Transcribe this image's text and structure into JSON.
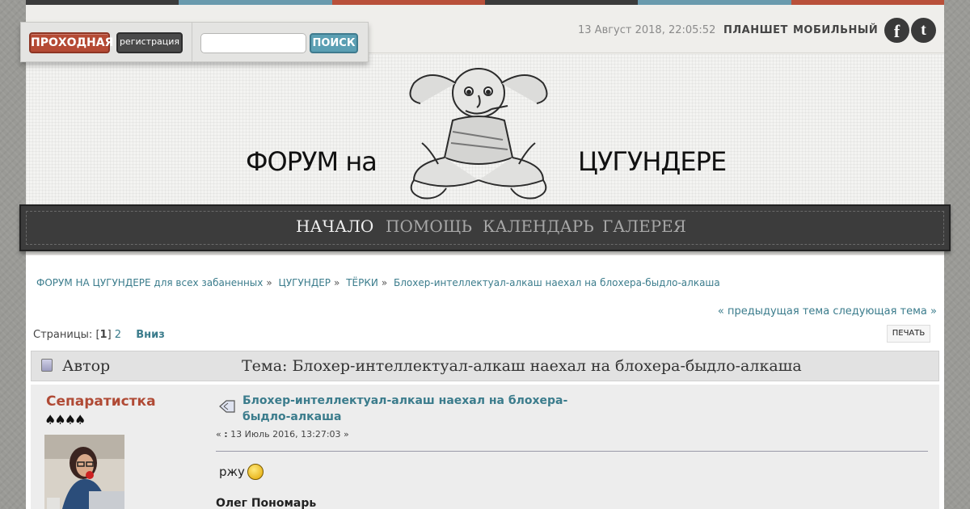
{
  "colors": {
    "stripes": [
      "#3b3b3b",
      "#6a9aad",
      "#b9503a",
      "#3b3b3b",
      "#6a9aad",
      "#b9503a"
    ],
    "accent_link": "#3b7c8c",
    "accent_red": "#b54a34"
  },
  "login": {
    "login_label": "ПРОХОДНАЯ",
    "register_label": "регистрация",
    "search_placeholder": "",
    "search_label": "ПОИСК"
  },
  "topbar": {
    "datetime": "13 Август 2018, 22:05:52",
    "tablet_link": "ПЛАНШЕТ",
    "mobile_link": "МОБИЛЬНЫЙ",
    "social": [
      {
        "icon": "facebook-icon",
        "glyph": "f"
      },
      {
        "icon": "twitter-icon",
        "glyph": "t"
      }
    ]
  },
  "header": {
    "logo_left": "ФОРУМ на",
    "logo_right": "ЦУГУНДЕРЕ"
  },
  "nav": {
    "items": [
      "НАЧАЛО",
      "ПОМОЩЬ",
      "КАЛЕНДАРЬ",
      "ГАЛЕРЕЯ"
    ],
    "active": "НАЧАЛО"
  },
  "breadcrumb": {
    "items": [
      "ФОРУМ НА ЦУГУНДЕРЕ для всех забаненных",
      "ЦУГУНДЕР",
      "ТЁРКИ",
      "Блохер-интеллектуал-алкаш наехал на блохера-быдло-алкаша"
    ],
    "separator": "»"
  },
  "topic_nav": {
    "prev": "« предыдущая тема",
    "next": "следующая тема »"
  },
  "pagination": {
    "label": "Страницы:",
    "current": "1",
    "other": "2",
    "down": "Вниз"
  },
  "print_label": "ПЕЧАТЬ",
  "table_header": {
    "author": "Автор",
    "topic": "Тема: Блохер-интеллектуал-алкаш наехал на блохера-быдло-алкаша"
  },
  "post": {
    "author": "Сепаратистка",
    "stars": "♠♠♠♠",
    "title": "Блохер-интеллектуал-алкаш наехал на блохера-быдло-алкаша",
    "date_prefix": "« ",
    "date_colon": ":",
    "date": " 13 Июль 2016, 13:27:03 »",
    "text": "ржу",
    "signature": "Олег Пономарь"
  }
}
